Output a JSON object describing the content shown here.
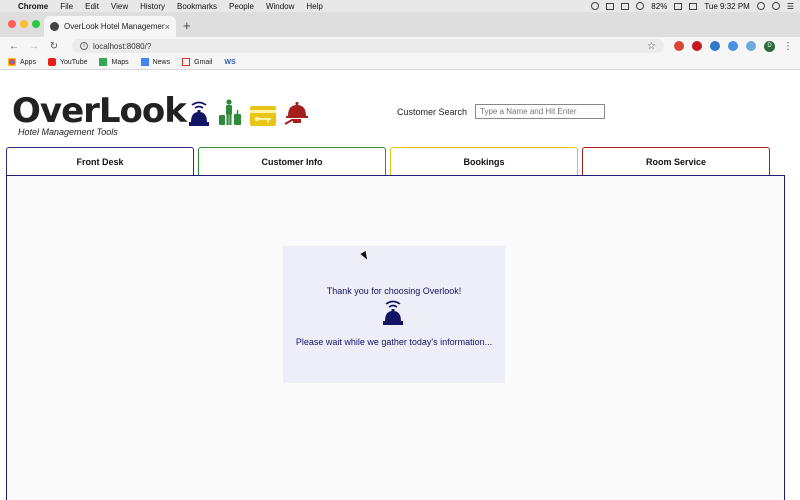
{
  "menubar": {
    "app": "Chrome",
    "items": [
      "File",
      "Edit",
      "View",
      "History",
      "Bookmarks",
      "People",
      "Window",
      "Help"
    ],
    "battery": "82%",
    "clock": "Tue 9:32 PM"
  },
  "browser": {
    "tab_title": "OverLook Hotel Management",
    "url": "localhost:8080/?",
    "profile_initial": "D",
    "bookmarks": [
      "Apps",
      "YouTube",
      "Maps",
      "News",
      "Gmail",
      "WS"
    ]
  },
  "app": {
    "title": "OverLook",
    "subtitle": "Hotel Management Tools",
    "hero_icons": [
      "service-bell-icon",
      "traveler-luggage-icon",
      "key-card-icon",
      "room-service-icon"
    ],
    "search_label": "Customer Search",
    "search_placeholder": "Type a Name and Hit Enter",
    "tabs": [
      {
        "label": "Front Desk",
        "color": "#2a2a8a"
      },
      {
        "label": "Customer Info",
        "color": "#2e8b3a"
      },
      {
        "label": "Bookings",
        "color": "#e8c516"
      },
      {
        "label": "Room Service",
        "color": "#a61f1f"
      }
    ],
    "loading": {
      "thanks": "Thank you for choosing Overlook!",
      "wait": "Please wait while we gather today's information..."
    }
  },
  "colors": {
    "navy": "#141464",
    "green": "#2e8b3a",
    "yellow": "#e8c516",
    "red": "#a61f1f"
  }
}
